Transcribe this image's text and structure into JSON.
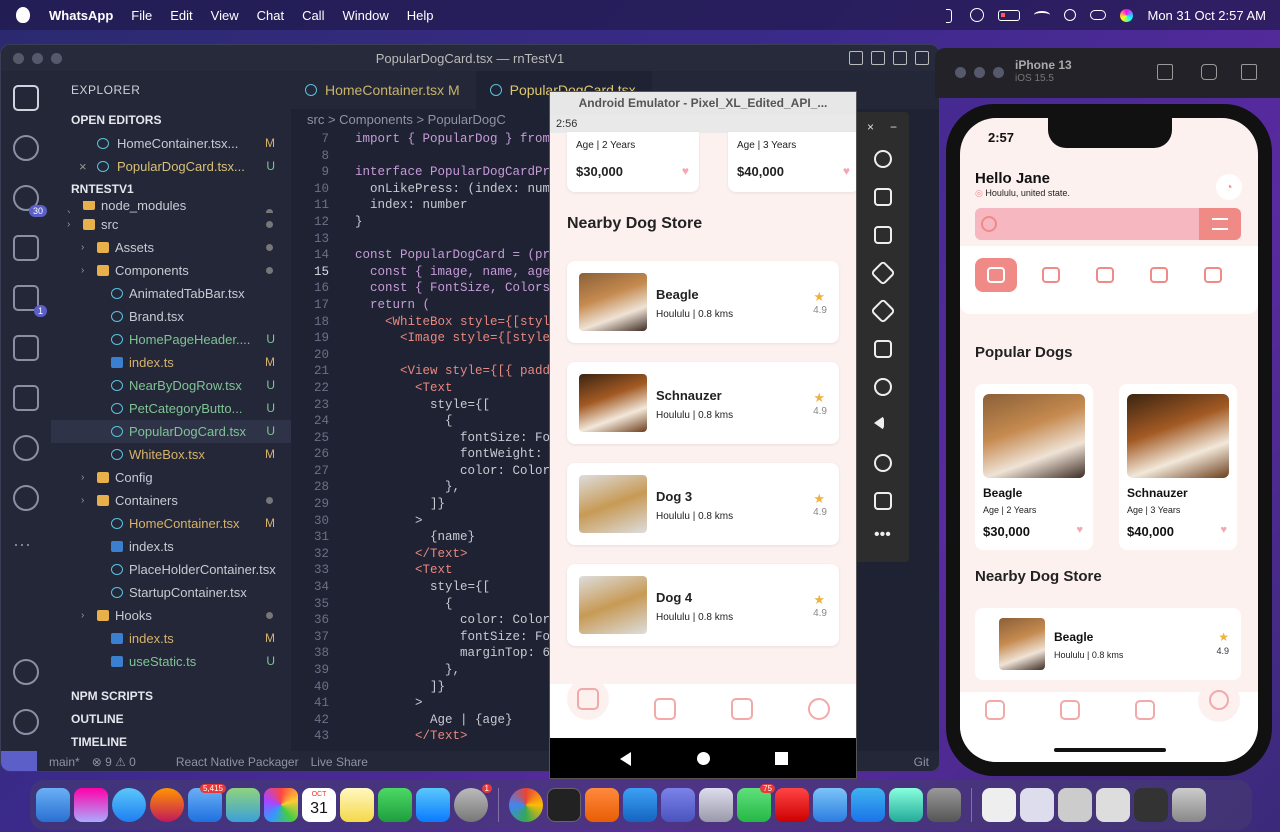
{
  "menubar": {
    "app": "WhatsApp",
    "items": [
      "File",
      "Edit",
      "View",
      "Chat",
      "Call",
      "Window",
      "Help"
    ],
    "datetime": "Mon 31 Oct  2:57 AM"
  },
  "vscode": {
    "title": "PopularDogCard.tsx — rnTestV1",
    "explorer_title": "EXPLORER",
    "open_editors": "OPEN EDITORS",
    "project": "RNTESTV1",
    "open_files": [
      {
        "name": "HomeContainer.tsx...",
        "status": "M"
      },
      {
        "name": "PopularDogCard.tsx...",
        "status": "U"
      }
    ],
    "tree": [
      {
        "name": "node_modules",
        "indent": 1,
        "kind": "folder",
        "status": "dot"
      },
      {
        "name": "src",
        "indent": 1,
        "kind": "folder",
        "status": "dot"
      },
      {
        "name": "Assets",
        "indent": 2,
        "kind": "folder",
        "status": "dot"
      },
      {
        "name": "Components",
        "indent": 2,
        "kind": "folder",
        "status": "dot"
      },
      {
        "name": "AnimatedTabBar.tsx",
        "indent": 3,
        "kind": "react",
        "status": ""
      },
      {
        "name": "Brand.tsx",
        "indent": 3,
        "kind": "react",
        "status": ""
      },
      {
        "name": "HomePageHeader....",
        "indent": 3,
        "kind": "react",
        "status": "U"
      },
      {
        "name": "index.ts",
        "indent": 3,
        "kind": "ts",
        "status": "M"
      },
      {
        "name": "NearByDogRow.tsx",
        "indent": 3,
        "kind": "react",
        "status": "U"
      },
      {
        "name": "PetCategoryButto...",
        "indent": 3,
        "kind": "react",
        "status": "U"
      },
      {
        "name": "PopularDogCard.tsx",
        "indent": 3,
        "kind": "react",
        "status": "U"
      },
      {
        "name": "WhiteBox.tsx",
        "indent": 3,
        "kind": "react",
        "status": "M"
      },
      {
        "name": "Config",
        "indent": 2,
        "kind": "folder",
        "status": ""
      },
      {
        "name": "Containers",
        "indent": 2,
        "kind": "folder",
        "status": "dot"
      },
      {
        "name": "HomeContainer.tsx",
        "indent": 3,
        "kind": "react",
        "status": "M"
      },
      {
        "name": "index.ts",
        "indent": 3,
        "kind": "ts",
        "status": ""
      },
      {
        "name": "PlaceHolderContainer.tsx",
        "indent": 3,
        "kind": "react",
        "status": ""
      },
      {
        "name": "StartupContainer.tsx",
        "indent": 3,
        "kind": "react",
        "status": ""
      },
      {
        "name": "Hooks",
        "indent": 2,
        "kind": "folder",
        "status": "dot"
      },
      {
        "name": "index.ts",
        "indent": 3,
        "kind": "ts",
        "status": "M"
      },
      {
        "name": "useStatic.ts",
        "indent": 3,
        "kind": "ts",
        "status": "U"
      }
    ],
    "bottom_sections": [
      "NPM SCRIPTS",
      "OUTLINE",
      "TIMELINE"
    ],
    "tabs": [
      {
        "label": "HomeContainer.tsx",
        "status": "M"
      },
      {
        "label": "PopularDogCard.tsx",
        "status": "U"
      }
    ],
    "breadcrumb": "src > Components > PopularDogC",
    "code": [
      {
        "n": "7",
        "t": "import { PopularDog } from"
      },
      {
        "n": "8",
        "t": ""
      },
      {
        "n": "9",
        "t": "interface PopularDogCardProp"
      },
      {
        "n": "10",
        "t": "  onLikePress: (index: numbe"
      },
      {
        "n": "11",
        "t": "  index: number"
      },
      {
        "n": "12",
        "t": "}"
      },
      {
        "n": "13",
        "t": ""
      },
      {
        "n": "14",
        "t": "const PopularDogCard = (prop"
      },
      {
        "n": "15",
        "t": "  const { image, name, age,"
      },
      {
        "n": "16",
        "t": "  const { FontSize, Colors,"
      },
      {
        "n": "17",
        "t": "  return ("
      },
      {
        "n": "18",
        "t": "    <WhiteBox style={[styles"
      },
      {
        "n": "19",
        "t": "      <Image style={[styles."
      },
      {
        "n": "20",
        "t": ""
      },
      {
        "n": "21",
        "t": "      <View style={[{ paddin"
      },
      {
        "n": "22",
        "t": "        <Text"
      },
      {
        "n": "23",
        "t": "          style={["
      },
      {
        "n": "24",
        "t": "            {"
      },
      {
        "n": "25",
        "t": "              fontSize: Font"
      },
      {
        "n": "26",
        "t": "              fontWeight: '7"
      },
      {
        "n": "27",
        "t": "              color: Colors."
      },
      {
        "n": "28",
        "t": "            },"
      },
      {
        "n": "29",
        "t": "          ]}"
      },
      {
        "n": "30",
        "t": "        >"
      },
      {
        "n": "31",
        "t": "          {name}"
      },
      {
        "n": "32",
        "t": "        </Text>"
      },
      {
        "n": "33",
        "t": "        <Text"
      },
      {
        "n": "34",
        "t": "          style={["
      },
      {
        "n": "35",
        "t": "            {"
      },
      {
        "n": "36",
        "t": "              color: Colors."
      },
      {
        "n": "37",
        "t": "              fontSize: Font"
      },
      {
        "n": "38",
        "t": "              marginTop: 6,"
      },
      {
        "n": "39",
        "t": "            },"
      },
      {
        "n": "40",
        "t": "          ]}"
      },
      {
        "n": "41",
        "t": "        >"
      },
      {
        "n": "42",
        "t": "          Age | {age}"
      },
      {
        "n": "43",
        "t": "        </Text>"
      }
    ],
    "current_line": "15",
    "status": {
      "branch": "main*",
      "problems": "⊗ 9  ⚠ 0",
      "packager": "React Native Packager",
      "liveshare": "Live Share",
      "git": "Git"
    },
    "badges": {
      "scm": "30",
      "ext": "1"
    }
  },
  "android": {
    "title": "Android Emulator - Pixel_XL_Edited_API_...",
    "time": "2:56",
    "top_cards": [
      {
        "age": "Age | 2 Years",
        "price": "$30,000"
      },
      {
        "age": "Age | 3 Years",
        "price": "$40,000"
      }
    ],
    "section": "Nearby Dog Store",
    "stores": [
      {
        "name": "Beagle",
        "loc": "Hoululu | 0.8 kms",
        "rating": "4.9"
      },
      {
        "name": "Schnauzer",
        "loc": "Hoululu | 0.8 kms",
        "rating": "4.9"
      },
      {
        "name": "Dog 3",
        "loc": "Hoululu | 0.8 kms",
        "rating": "4.9"
      },
      {
        "name": "Dog 4",
        "loc": "Hoululu | 0.8 kms",
        "rating": "4.9"
      }
    ]
  },
  "iphone": {
    "panel_title": "iPhone 13",
    "panel_os": "iOS 15.5",
    "time": "2:57",
    "greeting": "Hello Jane",
    "location": "Hoululu, united state.",
    "popular_title": "Popular Dogs",
    "popular": [
      {
        "name": "Beagle",
        "age": "Age | 2 Years",
        "price": "$30,000"
      },
      {
        "name": "Schnauzer",
        "age": "Age | 3 Years",
        "price": "$40,000"
      }
    ],
    "nearby_title": "Nearby Dog Store",
    "store": {
      "name": "Beagle",
      "loc": "Hoululu | 0.8 kms",
      "rating": "4.9"
    }
  },
  "dock": {
    "badges": {
      "mail": "5,415",
      "sysprefs": "1",
      "whatsapp": "75"
    },
    "calendar_month": "OCT",
    "calendar_day": "31"
  }
}
